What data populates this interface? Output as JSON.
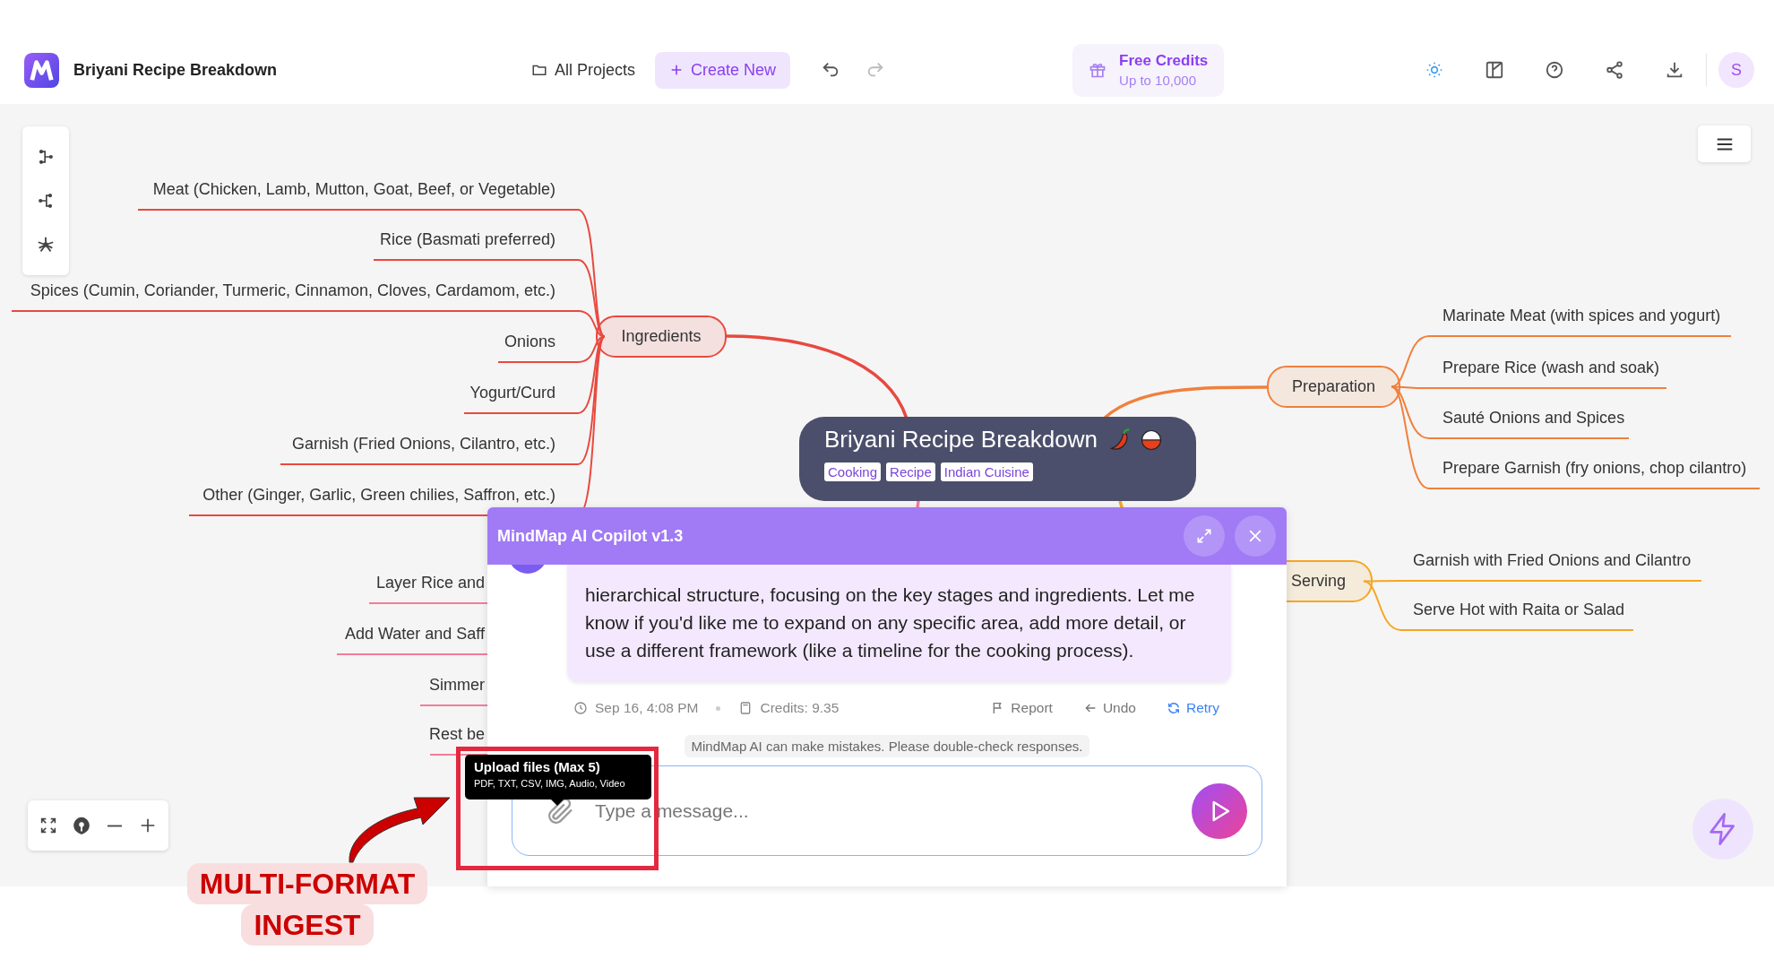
{
  "app": {
    "title": "Briyani Recipe Breakdown"
  },
  "toolbar": {
    "all_projects": "All Projects",
    "create_new": "Create New"
  },
  "credits": {
    "title": "Free Credits",
    "subtitle": "Up to 10,000"
  },
  "user": {
    "initial": "S"
  },
  "mindmap": {
    "central": {
      "title": "Briyani Recipe Breakdown",
      "tags": [
        "Cooking",
        "Recipe",
        "Indian Cuisine"
      ]
    },
    "branches": [
      {
        "label": "Ingredients",
        "color": "#e8493f",
        "children": [
          {
            "label": "Meat (Chicken, Lamb, Mutton, Goat, Beef, or Vegetable)"
          },
          {
            "label": "Rice (Basmati preferred)"
          },
          {
            "label": "Spices (Cumin, Coriander, Turmeric, Cinnamon, Cloves, Cardamom, etc.)"
          },
          {
            "label": "Onions"
          },
          {
            "label": "Yogurt/Curd"
          },
          {
            "label": "Garnish (Fried Onions, Cilantro, etc.)"
          },
          {
            "label": "Other (Ginger, Garlic, Green chilies, Saffron, etc.)"
          }
        ]
      },
      {
        "label": "Preparation",
        "color": "#f0803c",
        "children": [
          {
            "label": "Marinate Meat (with spices and yogurt)"
          },
          {
            "label": "Prepare Rice (wash and soak)"
          },
          {
            "label": "Sauté Onions and Spices"
          },
          {
            "label": "Prepare Garnish (fry onions, chop cilantro)"
          }
        ]
      },
      {
        "color": "#f47c9b",
        "children": [
          {
            "label": "Layer Rice and"
          },
          {
            "label": "Add Water and Saff"
          },
          {
            "label": "Simmer"
          },
          {
            "label": "Rest be"
          }
        ]
      },
      {
        "label": "Serving",
        "color": "#f5a623",
        "children": [
          {
            "label": "Garnish with Fried Onions and Cilantro"
          },
          {
            "label": "Serve Hot with Raita or Salad"
          }
        ]
      }
    ]
  },
  "copilot": {
    "title": "MindMap AI Copilot v1.3",
    "message": {
      "text": "hierarchical structure, focusing on the key stages and ingredients. Let me know if you'd like me to expand on any specific area, add more detail, or use a different framework (like a timeline for the cooking process).",
      "time": "Sep 16, 4:08 PM",
      "credits": "Credits: 9.35"
    },
    "actions": [
      {
        "label": "Report",
        "kind": "report"
      },
      {
        "label": "Undo",
        "kind": "undo"
      },
      {
        "label": "Retry",
        "kind": "retry"
      }
    ],
    "disclaimer": "MindMap AI can make mistakes. Please double-check responses.",
    "input": {
      "placeholder": "Type a message..."
    },
    "tooltip": {
      "title": "Upload files (Max 5)",
      "formats": "PDF, TXT, CSV, IMG, Audio, Video"
    }
  },
  "annotation": {
    "lines": [
      "MULTI-FORMAT",
      "INGEST"
    ]
  }
}
